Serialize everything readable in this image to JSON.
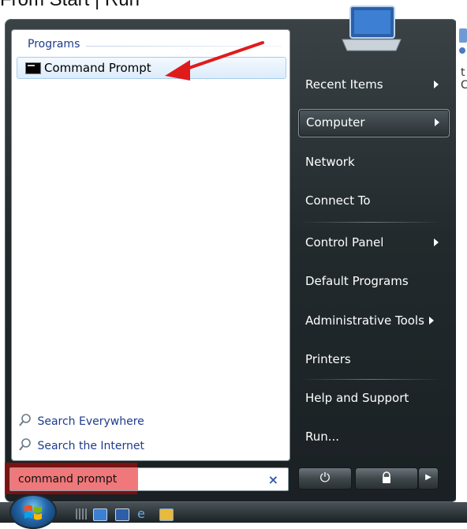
{
  "caption": "From Start | Run",
  "edge_text": "t C",
  "left_pane": {
    "programs_header": "Programs",
    "program_item": "Command Prompt",
    "search_everywhere": "Search Everywhere",
    "search_internet": "Search the Internet"
  },
  "right_pane": {
    "items": [
      {
        "label": "Recent Items",
        "has_submenu": true
      },
      {
        "label": "Computer",
        "has_submenu": true
      },
      {
        "label": "Network",
        "has_submenu": false
      },
      {
        "label": "Connect To",
        "has_submenu": false
      },
      {
        "label": "Control Panel",
        "has_submenu": true
      },
      {
        "label": "Default Programs",
        "has_submenu": false
      },
      {
        "label": "Administrative Tools",
        "has_submenu": true
      },
      {
        "label": "Printers",
        "has_submenu": false
      },
      {
        "label": "Help and Support",
        "has_submenu": false
      },
      {
        "label": "Run...",
        "has_submenu": false
      }
    ]
  },
  "search": {
    "value": "command prompt",
    "clear_glyph": "×"
  },
  "power": {
    "power_glyph": "⏻",
    "lock_glyph": "🔒",
    "more_glyph": "▶"
  },
  "colors": {
    "highlight": "#f0787a",
    "arrow": "#e01b1b",
    "link": "#1e3b8e"
  }
}
